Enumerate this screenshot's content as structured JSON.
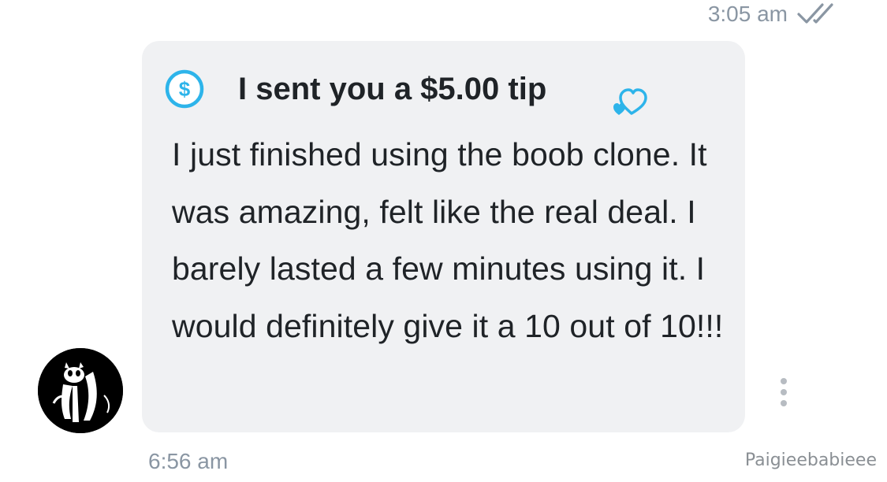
{
  "previous_message": {
    "time": "3:05 am",
    "status_icon": "double-check-icon"
  },
  "message": {
    "tip": {
      "icon": "dollar-circle-icon",
      "label": "I sent you a $5.00 tip",
      "reaction_icon": "hearts-icon"
    },
    "text": "I just finished using the boob clone. It was amazing, felt like the real deal. I barely lasted a few minutes using it. I would definitely give it a 10 out of 10!!!",
    "time": "6:56 am",
    "sender_avatar": "avatar",
    "more_icon": "more-vertical-icon"
  },
  "watermark": "Paigieebabieee",
  "colors": {
    "accent": "#2db4ea",
    "bubble": "#f0f1f3",
    "text": "#1f2327",
    "muted": "#8a96a3"
  }
}
